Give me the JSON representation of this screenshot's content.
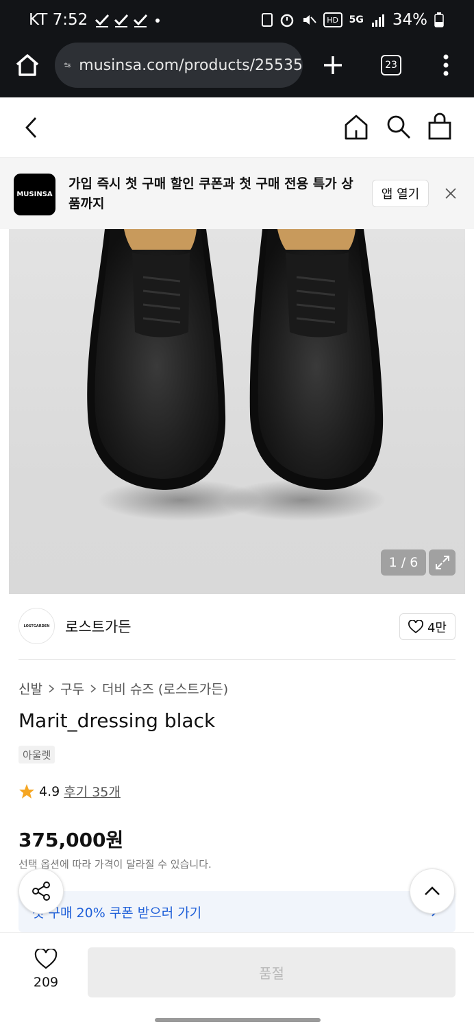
{
  "status_bar": {
    "carrier_time": "KT 7:52",
    "battery": "34%",
    "network": "5G"
  },
  "browser": {
    "url": "musinsa.com/products/25535",
    "tab_count": "23"
  },
  "banner": {
    "logo_text": "MUSINSA",
    "text": "가입 즉시 첫 구매 할인 쿠폰과 첫 구매 전용 특가 상품까지",
    "open_app_label": "앱 열기"
  },
  "gallery": {
    "counter": "1 / 6"
  },
  "brand": {
    "logo_text": "LOSTGARDEN",
    "name": "로스트가든",
    "likes": "4만"
  },
  "breadcrumb": {
    "items": [
      "신발",
      "구두",
      "더비 슈즈 (로스트가든)"
    ]
  },
  "product": {
    "title": "Marit_dressing black",
    "tag": "아울렛",
    "rating": "4.9",
    "reviews": "후기 35개",
    "price": "375,000원",
    "price_note": "선택 옵션에 따라 가격이 달라질 수 있습니다."
  },
  "coupon": {
    "label": "첫 구매 20% 쿠폰 받으러 가기"
  },
  "bottom_bar": {
    "wish_count": "209",
    "buy_label": "품절"
  },
  "colors": {
    "accent_star": "#f5a623",
    "coupon_blue": "#1e5fd8"
  }
}
